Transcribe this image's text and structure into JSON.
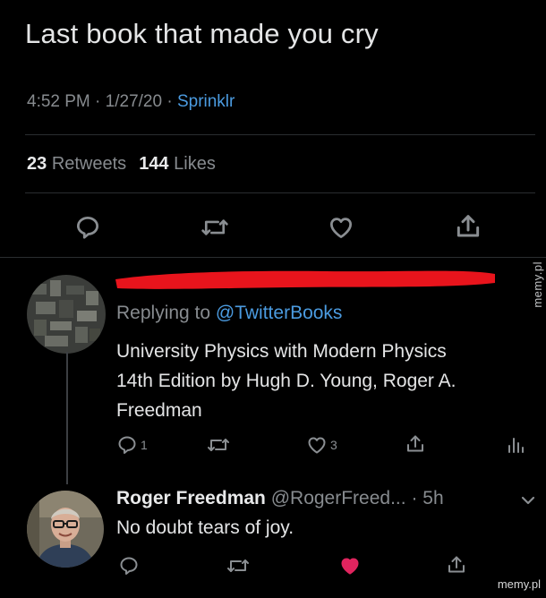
{
  "tweet": {
    "text": "Last book that made you cry",
    "time": "4:52 PM",
    "date": "1/27/20",
    "source": "Sprinklr",
    "separator": "·",
    "retweets_count": "23",
    "retweets_label": "Retweets",
    "likes_count": "144",
    "likes_label": "Likes"
  },
  "reply1": {
    "replying_to_label": "Replying to",
    "replying_to_handle": "@TwitterBooks",
    "body_lines": [
      "University Physics with Modern Physics",
      "14th Edition by Hugh D. Young, Roger A.",
      "Freedman"
    ],
    "reply_count": "1",
    "like_count": "3"
  },
  "reply2": {
    "name": "Roger Freedman",
    "handle": "@RogerFreed...",
    "time": "· 5h",
    "text": "No doubt tears of joy.",
    "liked": true
  },
  "watermark": {
    "side": "memy.pl",
    "bottom": "memy.pl"
  },
  "colors": {
    "background": "#000000",
    "link": "#4b9be0",
    "like_active": "#e0245e",
    "redaction": "#e8141c"
  },
  "icons": [
    "reply-icon",
    "retweet-icon",
    "heart-icon",
    "share-icon",
    "analytics-icon",
    "chevron-down-icon"
  ]
}
